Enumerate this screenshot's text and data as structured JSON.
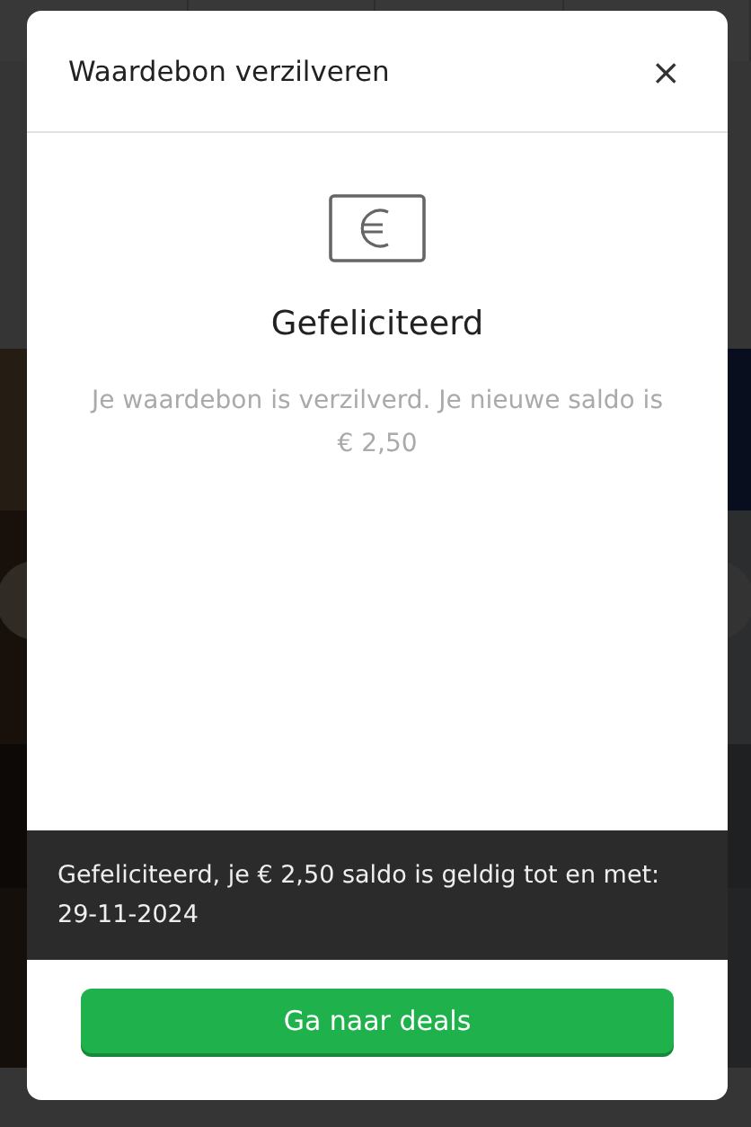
{
  "dialog": {
    "title": "Waardebon verzilveren",
    "close": "×",
    "heading": "Gefeliciteerd",
    "message": "Je waardebon is verzilverd. Je nieuwe saldo is € 2,50",
    "banner": "Gefeliciteerd, je € 2,50 saldo is geldig tot en met: 29-11-2024",
    "button": "Ga naar deals"
  }
}
